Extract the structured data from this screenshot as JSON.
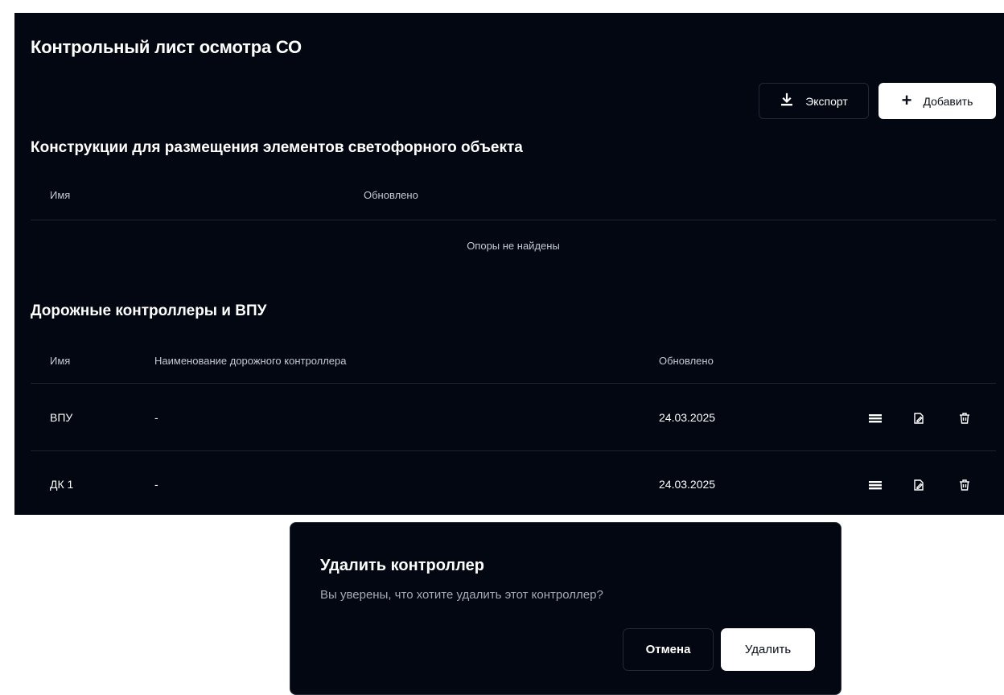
{
  "page": {
    "title": "Контрольный лист осмотра СО",
    "export_label": "Экспорт",
    "add_label": "Добавить",
    "add_icon": "+"
  },
  "section_supports": {
    "title": "Конструкции для размещения элементов светофорного объекта",
    "columns": [
      "Имя",
      "Обновлено"
    ],
    "empty_text": "Опоры не найдены"
  },
  "section_controllers": {
    "title": "Дорожные контроллеры и ВПУ",
    "columns": [
      "Имя",
      "Наименование дорожного контроллера",
      "Обновлено"
    ],
    "rows": [
      {
        "name": "ВПУ",
        "controller_name": "-",
        "updated": "24.03.2025"
      },
      {
        "name": "ДК 1",
        "controller_name": "-",
        "updated": "24.03.2025"
      }
    ]
  },
  "modal": {
    "title": "Удалить контроллер",
    "text": "Вы уверены, что хотите удалить этот контроллер?",
    "cancel_label": "Отмена",
    "delete_label": "Удалить"
  },
  "icons": {
    "export": "download-icon",
    "add": "plus-icon",
    "row_actions": [
      "menu-icon",
      "edit-document-icon",
      "trash-icon"
    ]
  },
  "colors": {
    "background": "#030712",
    "border": "#232838",
    "muted_text": "#c3c8d2",
    "primary_button": "#ffffff"
  }
}
